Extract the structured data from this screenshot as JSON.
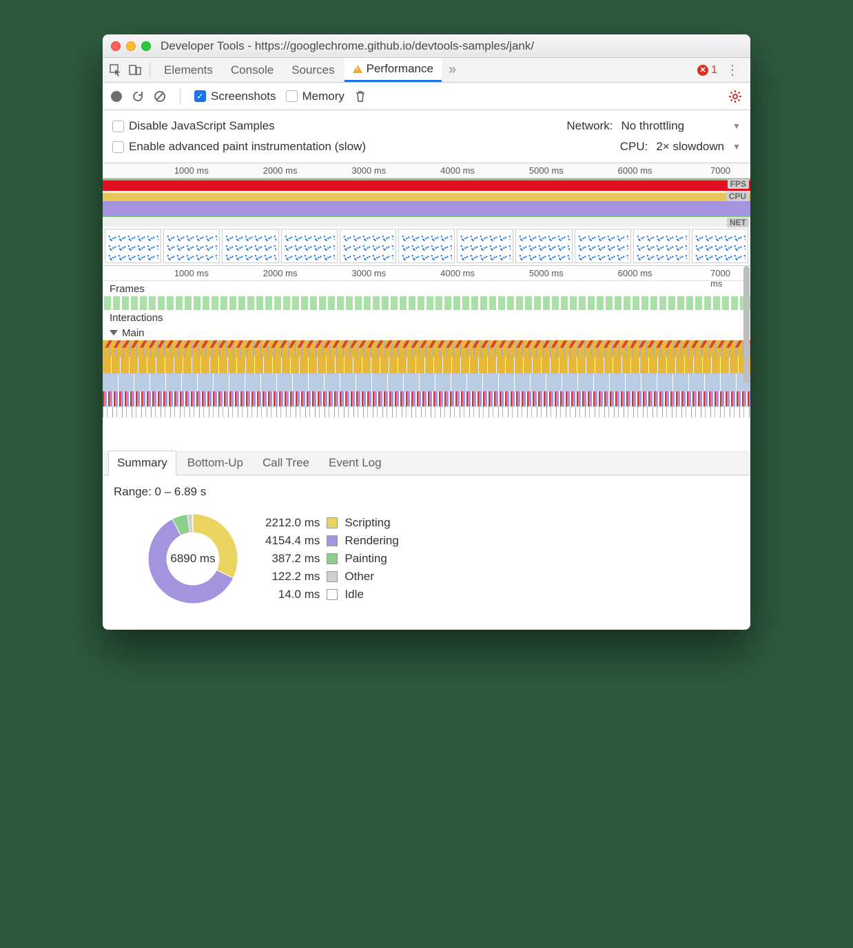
{
  "window": {
    "title": "Developer Tools - https://googlechrome.github.io/devtools-samples/jank/"
  },
  "tabs": {
    "items": [
      "Elements",
      "Console",
      "Sources",
      "Performance"
    ],
    "active": "Performance",
    "errors": "1"
  },
  "toolbar": {
    "screenshots_label": "Screenshots",
    "memory_label": "Memory"
  },
  "options": {
    "disable_js": "Disable JavaScript Samples",
    "paint_instr": "Enable advanced paint instrumentation (slow)",
    "network_label": "Network:",
    "network_value": "No throttling",
    "cpu_label": "CPU:",
    "cpu_value": "2× slowdown"
  },
  "ruler": {
    "ticks": [
      "1000 ms",
      "2000 ms",
      "3000 ms",
      "4000 ms",
      "5000 ms",
      "6000 ms",
      "7000 ms"
    ]
  },
  "overview_lanes": {
    "fps": "FPS",
    "cpu": "CPU",
    "net": "NET"
  },
  "tracks": {
    "frames": "Frames",
    "interactions": "Interactions",
    "main": "Main"
  },
  "summary_tabs": [
    "Summary",
    "Bottom-Up",
    "Call Tree",
    "Event Log"
  ],
  "summary_active": "Summary",
  "summary": {
    "range": "Range: 0 – 6.89 s",
    "total": "6890 ms",
    "legend": [
      {
        "value": "2212.0 ms",
        "label": "Scripting",
        "color": "#ead35e"
      },
      {
        "value": "4154.4 ms",
        "label": "Rendering",
        "color": "#a593e0"
      },
      {
        "value": "387.2 ms",
        "label": "Painting",
        "color": "#8bcf8b"
      },
      {
        "value": "122.2 ms",
        "label": "Other",
        "color": "#d0d0d0"
      },
      {
        "value": "14.0 ms",
        "label": "Idle",
        "color": "#ffffff"
      }
    ]
  },
  "chart_data": {
    "type": "pie",
    "title": "Time breakdown",
    "total_ms": 6890,
    "series": [
      {
        "name": "Scripting",
        "value": 2212.0,
        "color": "#ead35e"
      },
      {
        "name": "Rendering",
        "value": 4154.4,
        "color": "#a593e0"
      },
      {
        "name": "Painting",
        "value": 387.2,
        "color": "#8bcf8b"
      },
      {
        "name": "Other",
        "value": 122.2,
        "color": "#d0d0d0"
      },
      {
        "name": "Idle",
        "value": 14.0,
        "color": "#ffffff"
      }
    ]
  }
}
